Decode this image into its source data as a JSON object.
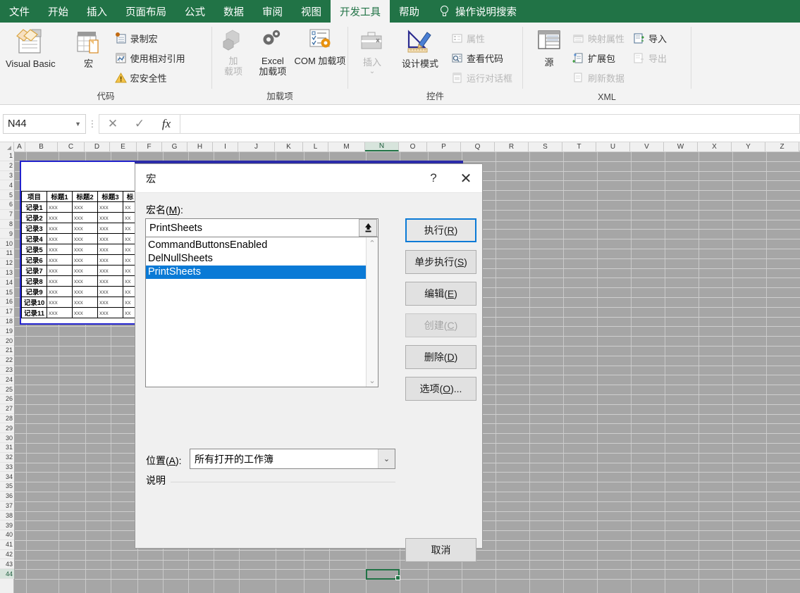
{
  "tabs": [
    {
      "label": "文件",
      "active": false
    },
    {
      "label": "开始",
      "active": false
    },
    {
      "label": "插入",
      "active": false
    },
    {
      "label": "页面布局",
      "active": false
    },
    {
      "label": "公式",
      "active": false
    },
    {
      "label": "数据",
      "active": false
    },
    {
      "label": "审阅",
      "active": false
    },
    {
      "label": "视图",
      "active": false
    },
    {
      "label": "开发工具",
      "active": true
    },
    {
      "label": "帮助",
      "active": false
    }
  ],
  "tellme": {
    "label": "操作说明搜索",
    "icon": "lightbulb-icon"
  },
  "ribbon": {
    "groups": [
      {
        "title": "代码",
        "big": [
          {
            "label": "Visual Basic",
            "icon": "visual-basic-icon",
            "disabled": false
          },
          {
            "label": "宏",
            "icon": "macro-icon",
            "disabled": false
          }
        ],
        "small": [
          {
            "label": "录制宏",
            "icon": "record-macro-icon",
            "disabled": false
          },
          {
            "label": "使用相对引用",
            "icon": "relative-reference-icon",
            "disabled": false
          },
          {
            "label": "宏安全性",
            "icon": "macro-security-icon",
            "disabled": false
          }
        ]
      },
      {
        "title": "加载项",
        "big": [
          {
            "label": "加\n载项",
            "label_l1": "加",
            "label_l2": "载项",
            "icon": "addins-icon",
            "disabled": true
          },
          {
            "label": "Excel\n加载项",
            "label_l1": "Excel",
            "label_l2": "加载项",
            "icon": "excel-addins-icon",
            "disabled": false
          },
          {
            "label": "COM 加载项",
            "label_l1": "COM 加载项",
            "label_l2": "",
            "icon": "com-addins-icon",
            "disabled": false
          }
        ],
        "small": []
      },
      {
        "title": "控件",
        "big": [
          {
            "label_l1": "插入",
            "label_l2": "⌄",
            "icon": "insert-control-icon",
            "disabled": true
          },
          {
            "label_l1": "设计模式",
            "label_l2": "",
            "icon": "design-mode-icon",
            "disabled": false
          }
        ],
        "small": [
          {
            "label": "属性",
            "icon": "properties-icon",
            "disabled": true
          },
          {
            "label": "查看代码",
            "icon": "view-code-icon",
            "disabled": false
          },
          {
            "label": "运行对话框",
            "icon": "run-dialog-icon",
            "disabled": true
          }
        ]
      },
      {
        "title": "XML",
        "big": [
          {
            "label_l1": "源",
            "label_l2": "",
            "icon": "xml-source-icon",
            "disabled": false
          }
        ],
        "small": [
          {
            "label": "映射属性",
            "icon": "map-properties-icon",
            "disabled": true
          },
          {
            "label": "扩展包",
            "icon": "expansion-pack-icon",
            "disabled": false
          },
          {
            "label": "刷新数据",
            "icon": "refresh-data-icon",
            "disabled": true
          }
        ],
        "small2": [
          {
            "label": "导入",
            "icon": "import-icon",
            "disabled": false
          },
          {
            "label": "导出",
            "icon": "export-icon",
            "disabled": true
          }
        ]
      }
    ]
  },
  "formula_bar": {
    "name_box_value": "N44",
    "cancel_icon": "cancel-x-icon",
    "confirm_icon": "confirm-check-icon",
    "function_icon": "fx-icon",
    "formula_value": ""
  },
  "grid": {
    "columns": [
      "A",
      "B",
      "C",
      "D",
      "E",
      "F",
      "G",
      "H",
      "I",
      "J",
      "K",
      "L",
      "M",
      "N",
      "O",
      "P",
      "Q",
      "R",
      "S",
      "T",
      "U",
      "V",
      "W",
      "X",
      "Y",
      "Z"
    ],
    "selected_column": "N",
    "row_count": 44,
    "selected_row": 44,
    "table": {
      "headers": [
        "项目",
        "标题1",
        "标题2",
        "标题3",
        "标"
      ],
      "rows": [
        [
          "记录1",
          "xxx",
          "xxx",
          "xxx",
          "xx"
        ],
        [
          "记录2",
          "xxx",
          "xxx",
          "xxx",
          "xx"
        ],
        [
          "记录3",
          "xxx",
          "xxx",
          "xxx",
          "xx"
        ],
        [
          "记录4",
          "xxx",
          "xxx",
          "xxx",
          "xx"
        ],
        [
          "记录5",
          "xxx",
          "xxx",
          "xxx",
          "xx"
        ],
        [
          "记录6",
          "xxx",
          "xxx",
          "xxx",
          "xx"
        ],
        [
          "记录7",
          "xxx",
          "xxx",
          "xxx",
          "xx"
        ],
        [
          "记录8",
          "xxx",
          "xxx",
          "xxx",
          "xx"
        ],
        [
          "记录9",
          "xxx",
          "xxx",
          "xxx",
          "xx"
        ],
        [
          "记录10",
          "xxx",
          "xxx",
          "xxx",
          "xx"
        ],
        [
          "记录11",
          "xxx",
          "xxx",
          "xxx",
          "xx"
        ]
      ]
    }
  },
  "dialog": {
    "title": "宏",
    "help_label": "?",
    "close_label": "✕",
    "macro_name_label_pre": "宏名(",
    "macro_name_label_key": "M",
    "macro_name_label_post": "):",
    "macro_name_value": "PrintSheets",
    "up_arrow_icon": "up-arrow-icon",
    "macro_list": [
      {
        "name": "CommandButtonsEnabled",
        "selected": false
      },
      {
        "name": "DelNullSheets",
        "selected": false
      },
      {
        "name": "PrintSheets",
        "selected": true
      }
    ],
    "scroll_up_icon": "chevron-up-icon",
    "scroll_down_icon": "chevron-down-icon",
    "buttons": [
      {
        "pre": "执行(",
        "key": "R",
        "post": ")",
        "primary": true,
        "disabled": false,
        "name": "run-button"
      },
      {
        "pre": "单步执行(",
        "key": "S",
        "post": ")",
        "primary": false,
        "disabled": false,
        "name": "step-into-button"
      },
      {
        "pre": "编辑(",
        "key": "E",
        "post": ")",
        "primary": false,
        "disabled": false,
        "name": "edit-button"
      },
      {
        "pre": "创建(",
        "key": "C",
        "post": ")",
        "primary": false,
        "disabled": true,
        "name": "create-button"
      },
      {
        "pre": "删除(",
        "key": "D",
        "post": ")",
        "primary": false,
        "disabled": false,
        "name": "delete-button"
      },
      {
        "pre": "选项(",
        "key": "O",
        "post": ")...",
        "primary": false,
        "disabled": false,
        "name": "options-button"
      }
    ],
    "location_label_pre": "位置(",
    "location_label_key": "A",
    "location_label_post": "):",
    "location_value": "所有打开的工作簿",
    "location_arrow_icon": "chevron-down-icon",
    "description_label": "说明",
    "description_value": "",
    "cancel_label": "取消"
  },
  "colors": {
    "ribbon_green": "#217346",
    "selection_blue": "#0a7ad6",
    "dialog_bg": "#f0f0f0",
    "grid_bg": "#a6a6a6",
    "table_border_blue": "#2222cc"
  }
}
